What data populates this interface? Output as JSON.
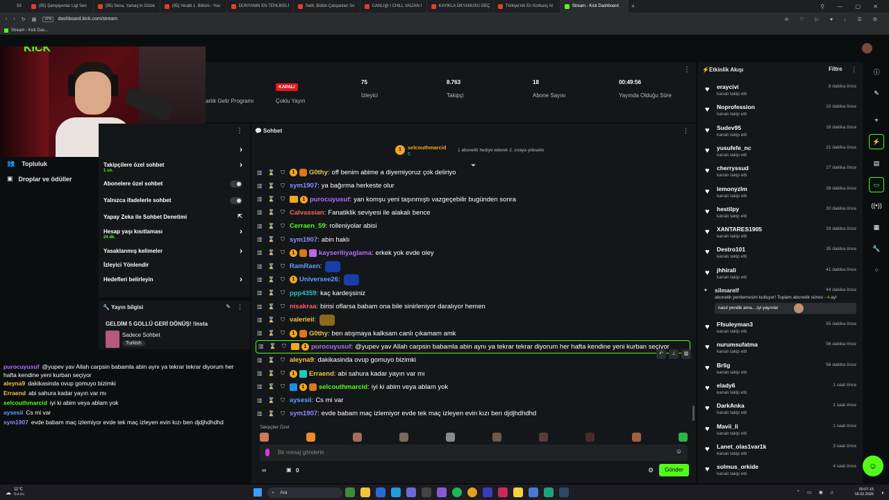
{
  "browser": {
    "tabs": [
      {
        "label": "(95) Şampiyonlar Ligi Sen",
        "active": false
      },
      {
        "label": "(95) Sena, Yamaç'ın Gözle",
        "active": false
      },
      {
        "label": "(95) Yeralti 1. Bölüm - You",
        "active": false
      },
      {
        "label": "DÜNYANIN EN TEHLİKELİ",
        "active": false
      },
      {
        "label": "Seth, Bütün Çalışanları Sır",
        "active": false
      },
      {
        "label": "CANLI@ I CHILL VALİAN I",
        "active": false
      },
      {
        "label": "KAYIKLA OKYANUSU GEÇ",
        "active": false
      },
      {
        "label": "Türkiye'nin En Korkunç Al",
        "active": false
      },
      {
        "label": "Stream - Kick Dashboard",
        "active": true
      }
    ],
    "tab_counter": "53",
    "url": "dashboard.kick.com/stream",
    "vpn": "VPN",
    "bookmark": "Stream - Kick Das..."
  },
  "webcam": {
    "overlay_text": "KICK",
    "beta": "BETA"
  },
  "left_nav": {
    "items": [
      {
        "label": "Topluluk"
      },
      {
        "label": "Droplar ve ödüller"
      }
    ]
  },
  "stats": {
    "partial_label": "arlık Gelir Programı",
    "status_badge": "KAPALI",
    "status_label": "Çoklu Yayın",
    "items": [
      {
        "value": "75",
        "label": "İzleyici"
      },
      {
        "value": "8.763",
        "label": "Takipçi"
      },
      {
        "value": "18",
        "label": "Abone Sayısı"
      },
      {
        "value": "00:49:56",
        "label": "Yayında Olduğu Süre"
      }
    ]
  },
  "settings": {
    "rows": [
      {
        "label": "",
        "type": "chevron"
      },
      {
        "label": "Takipçilere özel sohbet",
        "sub": "1 sn.",
        "type": "chevron"
      },
      {
        "label": "Abonelere özel sohbet",
        "type": "toggle"
      },
      {
        "label": "Yalnızca ifadelerle sohbet",
        "type": "toggle"
      },
      {
        "label": "Yapay Zeka ile Sohbet Denetimi",
        "type": "external"
      },
      {
        "label": "Hesap yaşı kısıtlaması",
        "sub": "24 dk.",
        "type": "chevron"
      },
      {
        "label": "Yasaklanmış kelimeler",
        "type": "chevron"
      },
      {
        "label": "İzleyici Yönlendir",
        "type": "none"
      },
      {
        "label": "Hedefleri belirleyin",
        "type": "chevron"
      }
    ]
  },
  "stream_info": {
    "title": "Yayın bilgisi",
    "stream_title": "GELDİM 5 GOLLÜ GERİ DÖNÜŞ! !insta",
    "category": "Sadece Sohbet",
    "tag": "Turkish"
  },
  "overlay_chat": [
    {
      "user": "purocuyusuf",
      "color": "#b46cff",
      "text": "@yupev yav Allah carpsin babamla abin aynı ya tekrar tekrar diyorum her hafta kendine yeni kurban seçiyor"
    },
    {
      "user": "aleyna9",
      "color": "#f5c542",
      "text": "dakikasinda ovup gomuyo bizimki"
    },
    {
      "user": "Erraend",
      "color": "#f5c542",
      "text": "abi sahura kadar yayın var mı"
    },
    {
      "user": "selcouthmarcid",
      "color": "#53fc18",
      "text": "iyi ki abim veya ablam yok"
    },
    {
      "user": "aysesii",
      "color": "#5aa0ff",
      "text": "Cs mi var"
    },
    {
      "user": "sym1907",
      "color": "#8d8dff",
      "text": "evde babam maç izlemiyor evde tek maç izleyen evin kızı ben djdjhdhdhd"
    }
  ],
  "chat": {
    "title": "Sohbet",
    "pinned_user": "selcouthmarcid",
    "pinned_count": "5",
    "pinned_text": "1 abonelik hediye ederek 2. sıraya yükselin",
    "messages": [
      {
        "user": "G0thy",
        "color": "#f5c542",
        "badges": [
          "sub",
          "lion"
        ],
        "text": "off benim abime a diyemiyoruz çok deliriyo"
      },
      {
        "user": "sym1907",
        "color": "#8d8dff",
        "badges": [],
        "text": "ya bağırma herkeste olur"
      },
      {
        "user": "purocuyusuf",
        "color": "#b46cff",
        "badges": [
          "crown",
          "sub"
        ],
        "text": "yan komşu yeni taşınmıştı vazgeçebilir bugünden sonra"
      },
      {
        "user": "Calvassian",
        "color": "#ff5e5e",
        "badges": [],
        "text": "Fanatiklik seviyesi ile alakalı bence"
      },
      {
        "user": "Cerraen_59",
        "color": "#53fc18",
        "badges": [],
        "text": "rolleniyolar abisi"
      },
      {
        "user": "sym1907",
        "color": "#8d8dff",
        "badges": [],
        "text": "abin haklı"
      },
      {
        "user": "kayseriliyaglama",
        "color": "#b46cff",
        "badges": [
          "sub",
          "lion",
          "gift"
        ],
        "text": "erkek yok evde oley"
      },
      {
        "user": "RamRaen",
        "color": "#5aa0ff",
        "badges": [],
        "text": "",
        "emote": "#1a3ea8"
      },
      {
        "user": "Universee26",
        "color": "#5aa0ff",
        "badges": [
          "sub"
        ],
        "text": "",
        "emote": "#1a3ea8"
      },
      {
        "user": "ppp4359",
        "color": "#24c6bf",
        "badges": [],
        "text": "kaç kardeşsiniz"
      },
      {
        "user": "nisakraa",
        "color": "#ff5e5e",
        "badges": [],
        "text": "birisi oflarsa babam ona bile sinirleniyor daralıyor hemen"
      },
      {
        "user": "valerieii",
        "color": "#f5c542",
        "badges": [],
        "text": "",
        "emote": "#8a6a1c"
      },
      {
        "user": "G0thy",
        "color": "#f5c542",
        "badges": [
          "sub",
          "lion"
        ],
        "text": "ben atışmaya kalksam canlı çıkamam amk"
      },
      {
        "user": "purocuyusuf",
        "color": "#b46cff",
        "badges": [
          "crown",
          "sub"
        ],
        "text": "@yupev yav Allah carpsin babamla abin aynı ya tekrar tekrar diyorum her hafta kendine yeni kurban seçiyor",
        "highlight": true
      },
      {
        "user": "aleyna9",
        "color": "#f5c542",
        "badges": [],
        "text": "dakikasinda ovup gomuyo bizimki"
      },
      {
        "user": "Erraend",
        "color": "#f5c542",
        "badges": [
          "sub",
          "teal"
        ],
        "text": "abi sahura kadar yayın var mı"
      },
      {
        "user": "selcouthmarcid",
        "color": "#53fc18",
        "badges": [
          "vip",
          "sub",
          "lion"
        ],
        "text": "iyi ki abim veya ablam yok"
      },
      {
        "user": "aysesii",
        "color": "#5aa0ff",
        "badges": [],
        "text": "Cs mi var"
      },
      {
        "user": "sym1907",
        "color": "#8d8dff",
        "badges": [],
        "text": "evde babam maç izlemiyor evde tek maç izleyen evin kızı ben djdjhdhdhd"
      }
    ],
    "followers_only_label": "Takipçiler Özel",
    "input_placeholder": "Bir mesaj gönderin",
    "send_label": "Gönder",
    "points": "0"
  },
  "activity": {
    "title": "Etkinlik Akışı",
    "filter_label": "Filtre",
    "items": [
      {
        "name": "eraycivi",
        "sub": "kanalı takip etti",
        "time": "8 dakika önce"
      },
      {
        "name": "Noprofession",
        "sub": "kanalı takip etti",
        "time": "10 dakika önce"
      },
      {
        "name": "Sudev95",
        "sub": "kanalı takip etti",
        "time": "18 dakika önce"
      },
      {
        "name": "yusufefe_nc",
        "sub": "kanalı takip etti",
        "time": "21 dakika önce"
      },
      {
        "name": "cherryssud",
        "sub": "kanalı takip etti",
        "time": "27 dakika önce"
      },
      {
        "name": "lemonyzlm",
        "sub": "kanalı takip etti",
        "time": "28 dakika önce"
      },
      {
        "name": "hestilpy",
        "sub": "kanalı takip etti",
        "time": "30 dakika önce"
      },
      {
        "name": "XANTARES1905",
        "sub": "kanalı takip etti",
        "time": "33 dakika önce"
      },
      {
        "name": "Destro101",
        "sub": "kanalı takip etti",
        "time": "35 dakika önce"
      },
      {
        "name": "jhhirali",
        "sub": "kanalı takip etti",
        "time": "41 dakika önce"
      }
    ],
    "resub": {
      "name": "silmarelf",
      "time": "44 dakika önce",
      "text_a": "abonelik yenilemesini kutluyor! Toplam abonelik süresi - ",
      "months": "4",
      "text_b": " ay!",
      "message": "nasıl yendik ama....iyi yayınlar"
    },
    "items2": [
      {
        "name": "Ffsuleyman3",
        "sub": "kanalı takip etti",
        "time": "55 dakika önce"
      },
      {
        "name": "nurumsufatma",
        "sub": "kanalı takip etti",
        "time": "56 dakika önce"
      },
      {
        "name": "Brlig",
        "sub": "kanalı takip etti",
        "time": "56 dakika önce"
      },
      {
        "name": "elady6",
        "sub": "kanalı takip etti",
        "time": "1 saat önce"
      },
      {
        "name": "DarkAnka",
        "sub": "kanalı takip etti",
        "time": "1 saat önce"
      },
      {
        "name": "Mavii_li",
        "sub": "kanalı takip etti",
        "time": "1 saat önce"
      },
      {
        "name": "Lanet_olas1var1k",
        "sub": "kanalı takip etti",
        "time": "3 saat önce"
      },
      {
        "name": "solmus_orkide",
        "sub": "kanalı takip etti",
        "time": "4 saat önce"
      }
    ]
  },
  "taskbar": {
    "weather_temp": "11°C",
    "weather_text": "Bulutlu",
    "search": "Ara",
    "time": "00:07:15",
    "date": "18.02.2026"
  },
  "colors": {
    "accent": "#53fc18",
    "panel": "#14171a",
    "bg": "#0b0e0f"
  }
}
